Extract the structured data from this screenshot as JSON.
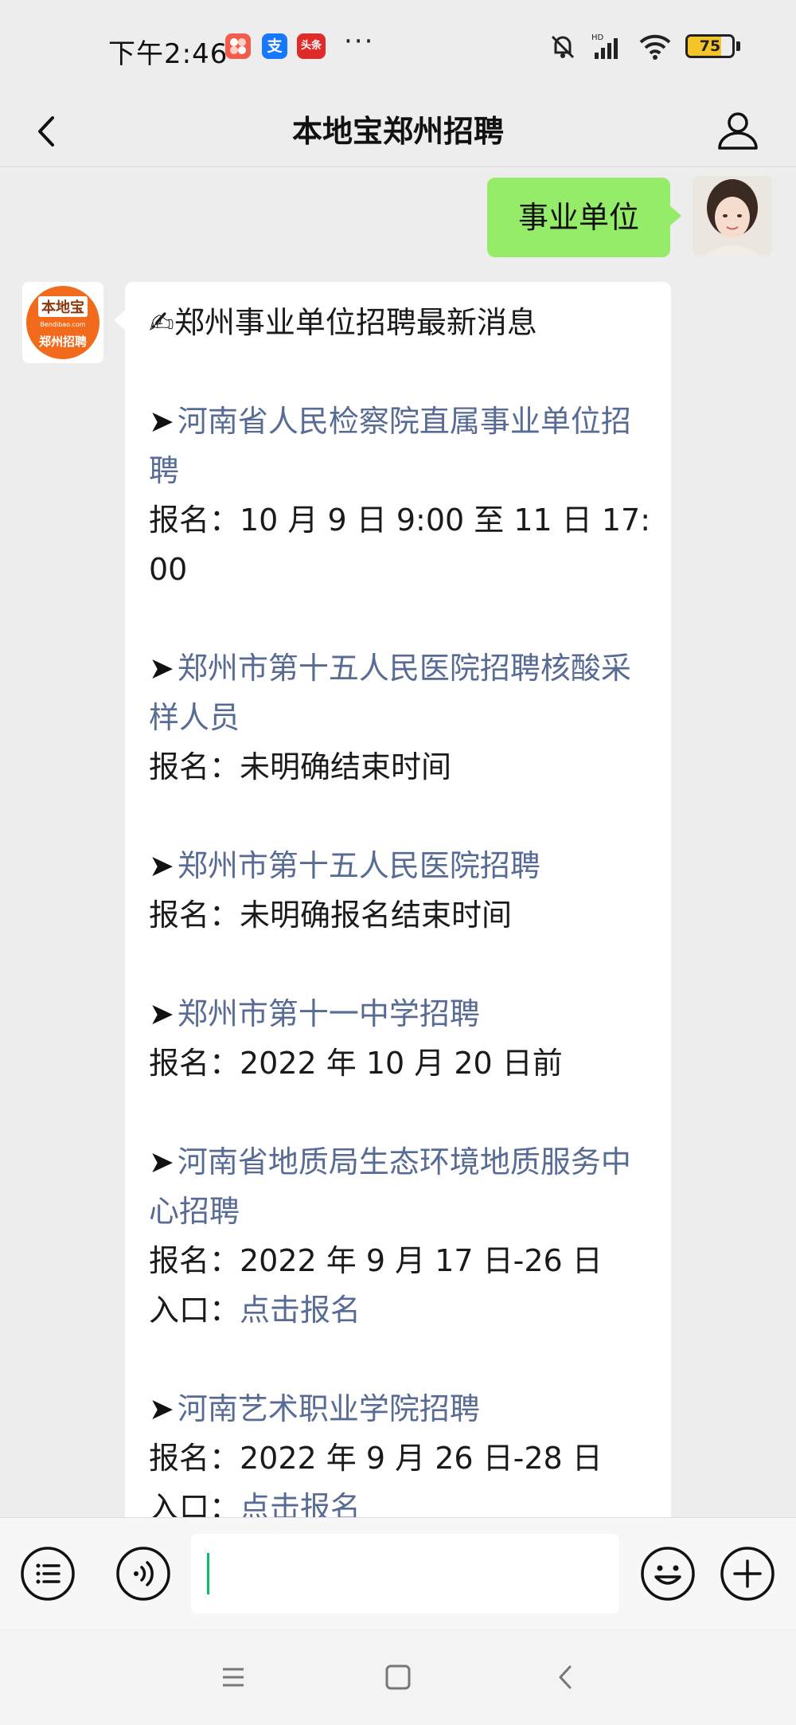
{
  "status_bar": {
    "time": "下午2:46",
    "app_badges": [
      "",
      "支",
      "头条"
    ],
    "more": "···",
    "battery_level": 75,
    "battery_text": "75"
  },
  "header": {
    "title": "本地宝郑州招聘"
  },
  "user_message": {
    "text": "事业单位"
  },
  "bot_avatar": {
    "line1": "本地宝",
    "line2": "Bendibao.com",
    "line3": "郑州招聘"
  },
  "bot_message": {
    "heading": "✍郑州事业单位招聘最新消息",
    "arrow": "➤",
    "items": [
      {
        "title": "河南省人民检察院直属事业单位招聘",
        "lines": [
          "报名：10 月 9 日 9:00 至 11 日 17:00"
        ]
      },
      {
        "title": "郑州市第十五人民医院招聘核酸采样人员",
        "lines": [
          "报名：未明确结束时间"
        ]
      },
      {
        "title": "郑州市第十五人民医院招聘",
        "lines": [
          "报名：未明确报名结束时间"
        ]
      },
      {
        "title": "郑州市第十一中学招聘",
        "lines": [
          "报名：2022 年 10 月 20 日前"
        ]
      },
      {
        "title": "河南省地质局生态环境地质服务中心招聘",
        "lines": [
          "报名：2022 年 9 月 17 日-26 日"
        ],
        "entry_label": "入口：",
        "entry_link": "点击报名"
      },
      {
        "title": "河南艺术职业学院招聘",
        "lines": [
          "报名：2022 年 9 月 26 日-28 日"
        ],
        "entry_label": "入口：",
        "entry_link": "点击报名"
      }
    ]
  },
  "input_bar": {
    "value": "",
    "placeholder": ""
  },
  "colors": {
    "background": "#ededed",
    "user_bubble": "#95ec69",
    "link": "#576b95",
    "caret": "#07c160",
    "avatar_brand": "#f26b1d"
  },
  "icons": [
    "menu-list-icon",
    "voice-icon",
    "emoji-icon",
    "plus-icon",
    "back-arrow-icon",
    "person-icon",
    "nav-menu-icon",
    "nav-home-icon",
    "nav-back-icon"
  ]
}
